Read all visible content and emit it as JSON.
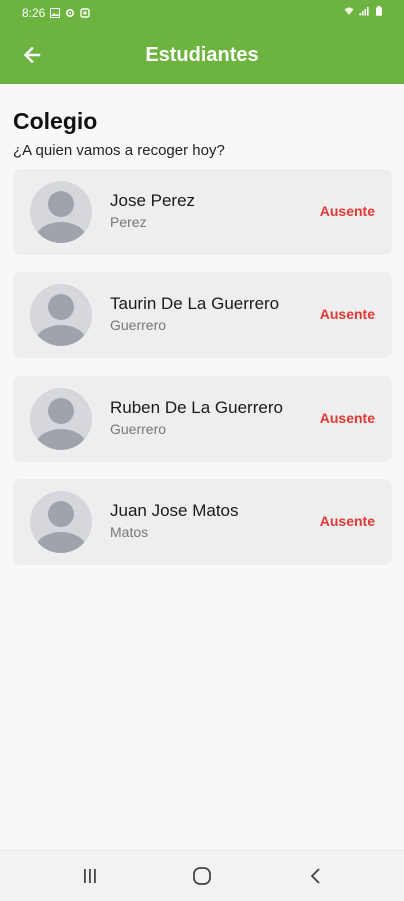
{
  "status_bar": {
    "time": "8:26"
  },
  "app_bar": {
    "title": "Estudiantes",
    "back_icon": "arrow-left-icon"
  },
  "header": {
    "title": "Colegio",
    "subtitle": "¿A quien vamos a recoger hoy?"
  },
  "students": [
    {
      "name": "Jose Perez",
      "last_name": "Perez",
      "status": "Ausente"
    },
    {
      "name": "Taurin De La Guerrero",
      "last_name": "Guerrero",
      "status": "Ausente"
    },
    {
      "name": "Ruben De La Guerrero",
      "last_name": "Guerrero",
      "status": "Ausente"
    },
    {
      "name": "Juan Jose Matos",
      "last_name": "Matos",
      "status": "Ausente"
    }
  ],
  "colors": {
    "primary": "#6db33f",
    "status_absent": "#e53935",
    "card_background": "#eeeeee",
    "avatar_background": "#d6d7dc"
  },
  "nav_bar": {
    "recents_icon": "recents-icon",
    "home_icon": "home-circle-icon",
    "back_icon": "chevron-left-icon"
  }
}
